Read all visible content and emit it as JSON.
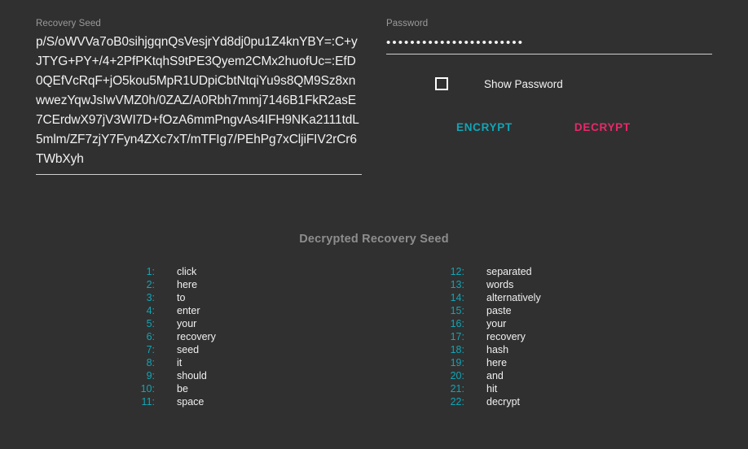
{
  "theme": {
    "background": "#303030",
    "text": "#f2f2f2",
    "muted": "#9a9a9a",
    "accent_teal": "#12a5b5",
    "accent_pink": "#e8286b",
    "underline": "#cfcfcf"
  },
  "recovery_seed": {
    "label": "Recovery Seed",
    "value": "p/S/oWVVa7oB0sihjgqnQsVesjrYd8dj0pu1Z4knYBY=:C+yJTYG+PY+/4+2PfPKtqhS9tPE3Qyem2CMx2huofUc=:EfD0QEfVcRqF+jO5kou5MpR1UDpiCbtNtqiYu9s8QM9Sz8xnwwezYqwJsIwVMZ0h/0ZAZ/A0Rbh7mmj7146B1FkR2asE7CErdwX97jV3WI7D+fOzA6mmPngvAs4IFH9NKa2111tdL5mlm/ZF7zjY7Fyn4ZXc7xT/mTFIg7/PEhPg7xCljiFIV2rCr6TWbXyh"
  },
  "password": {
    "label": "Password",
    "masked_value": "•••••••••••••••••••••••",
    "placeholder": ""
  },
  "show_password": {
    "label": "Show Password",
    "checked": false
  },
  "actions": {
    "encrypt_label": "ENCRYPT",
    "decrypt_label": "DECRYPT"
  },
  "results": {
    "title": "Decrypted Recovery Seed",
    "left_column": [
      {
        "num": "1:",
        "word": "click"
      },
      {
        "num": "2:",
        "word": "here"
      },
      {
        "num": "3:",
        "word": "to"
      },
      {
        "num": "4:",
        "word": "enter"
      },
      {
        "num": "5:",
        "word": "your"
      },
      {
        "num": "6:",
        "word": "recovery"
      },
      {
        "num": "7:",
        "word": "seed"
      },
      {
        "num": "8:",
        "word": "it"
      },
      {
        "num": "9:",
        "word": "should"
      },
      {
        "num": "10:",
        "word": "be"
      },
      {
        "num": "11:",
        "word": "space"
      }
    ],
    "right_column": [
      {
        "num": "12:",
        "word": "separated"
      },
      {
        "num": "13:",
        "word": "words"
      },
      {
        "num": "14:",
        "word": "alternatively"
      },
      {
        "num": "15:",
        "word": "paste"
      },
      {
        "num": "16:",
        "word": "your"
      },
      {
        "num": "17:",
        "word": "recovery"
      },
      {
        "num": "18:",
        "word": "hash"
      },
      {
        "num": "19:",
        "word": "here"
      },
      {
        "num": "20:",
        "word": "and"
      },
      {
        "num": "21:",
        "word": "hit"
      },
      {
        "num": "22:",
        "word": "decrypt"
      }
    ]
  }
}
